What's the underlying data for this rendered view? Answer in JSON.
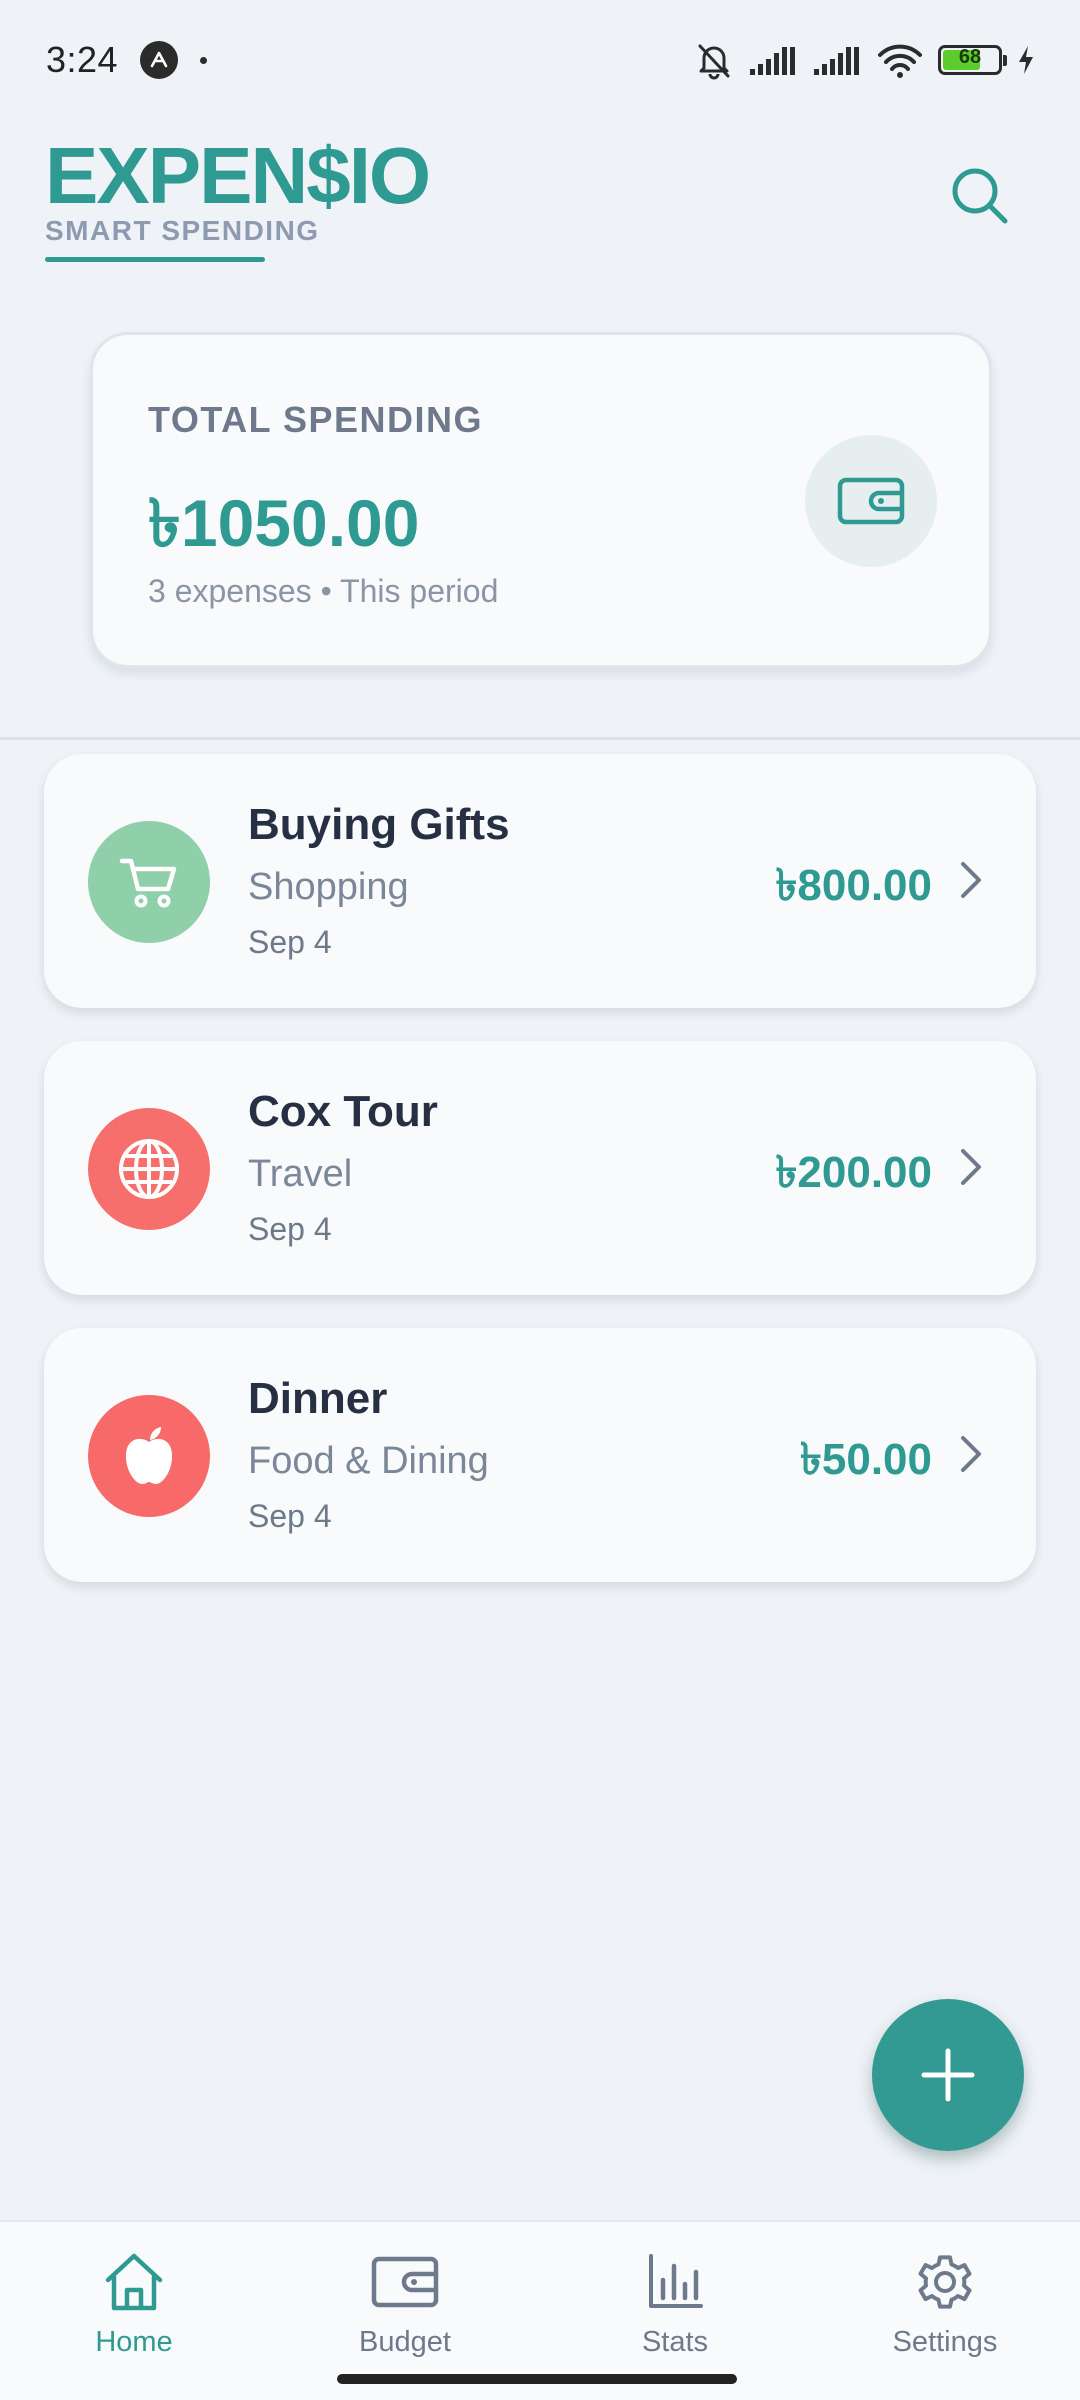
{
  "status_bar": {
    "time": "3:24",
    "battery_level": "68",
    "battery_fraction": 0.68,
    "icons": [
      "app-notification-icon",
      "bell-off-icon",
      "signal-icon",
      "signal-icon",
      "wifi-icon",
      "battery-icon",
      "charging-icon"
    ]
  },
  "header": {
    "logo": "EXPEN$IO",
    "tagline": "SMART SPENDING",
    "search_icon": "search-icon"
  },
  "summary": {
    "label": "TOTAL SPENDING",
    "amount": "৳1050.00",
    "subtitle": "3 expenses • This period",
    "icon": "wallet-icon"
  },
  "expenses": [
    {
      "title": "Buying Gifts",
      "category": "Shopping",
      "date": "Sep 4",
      "amount": "৳800.00",
      "icon": "cart-icon",
      "color": "#8fcfa9"
    },
    {
      "title": "Cox Tour",
      "category": "Travel",
      "date": "Sep 4",
      "amount": "৳200.00",
      "icon": "globe-icon",
      "color": "#f76f6c"
    },
    {
      "title": "Dinner",
      "category": "Food & Dining",
      "date": "Sep 4",
      "amount": "৳50.00",
      "icon": "apple-icon",
      "color": "#f76a69"
    }
  ],
  "fab": {
    "icon": "plus-icon"
  },
  "nav": [
    {
      "label": "Home",
      "icon": "home-icon",
      "active": true
    },
    {
      "label": "Budget",
      "icon": "wallet-icon",
      "active": false
    },
    {
      "label": "Stats",
      "icon": "bar-chart-icon",
      "active": false
    },
    {
      "label": "Settings",
      "icon": "gear-icon",
      "active": false
    }
  ],
  "colors": {
    "accent": "#2f9a92",
    "background": "#eff3f7",
    "card": "#f8fafc",
    "text_primary": "#273043",
    "text_secondary": "#7b8798"
  }
}
